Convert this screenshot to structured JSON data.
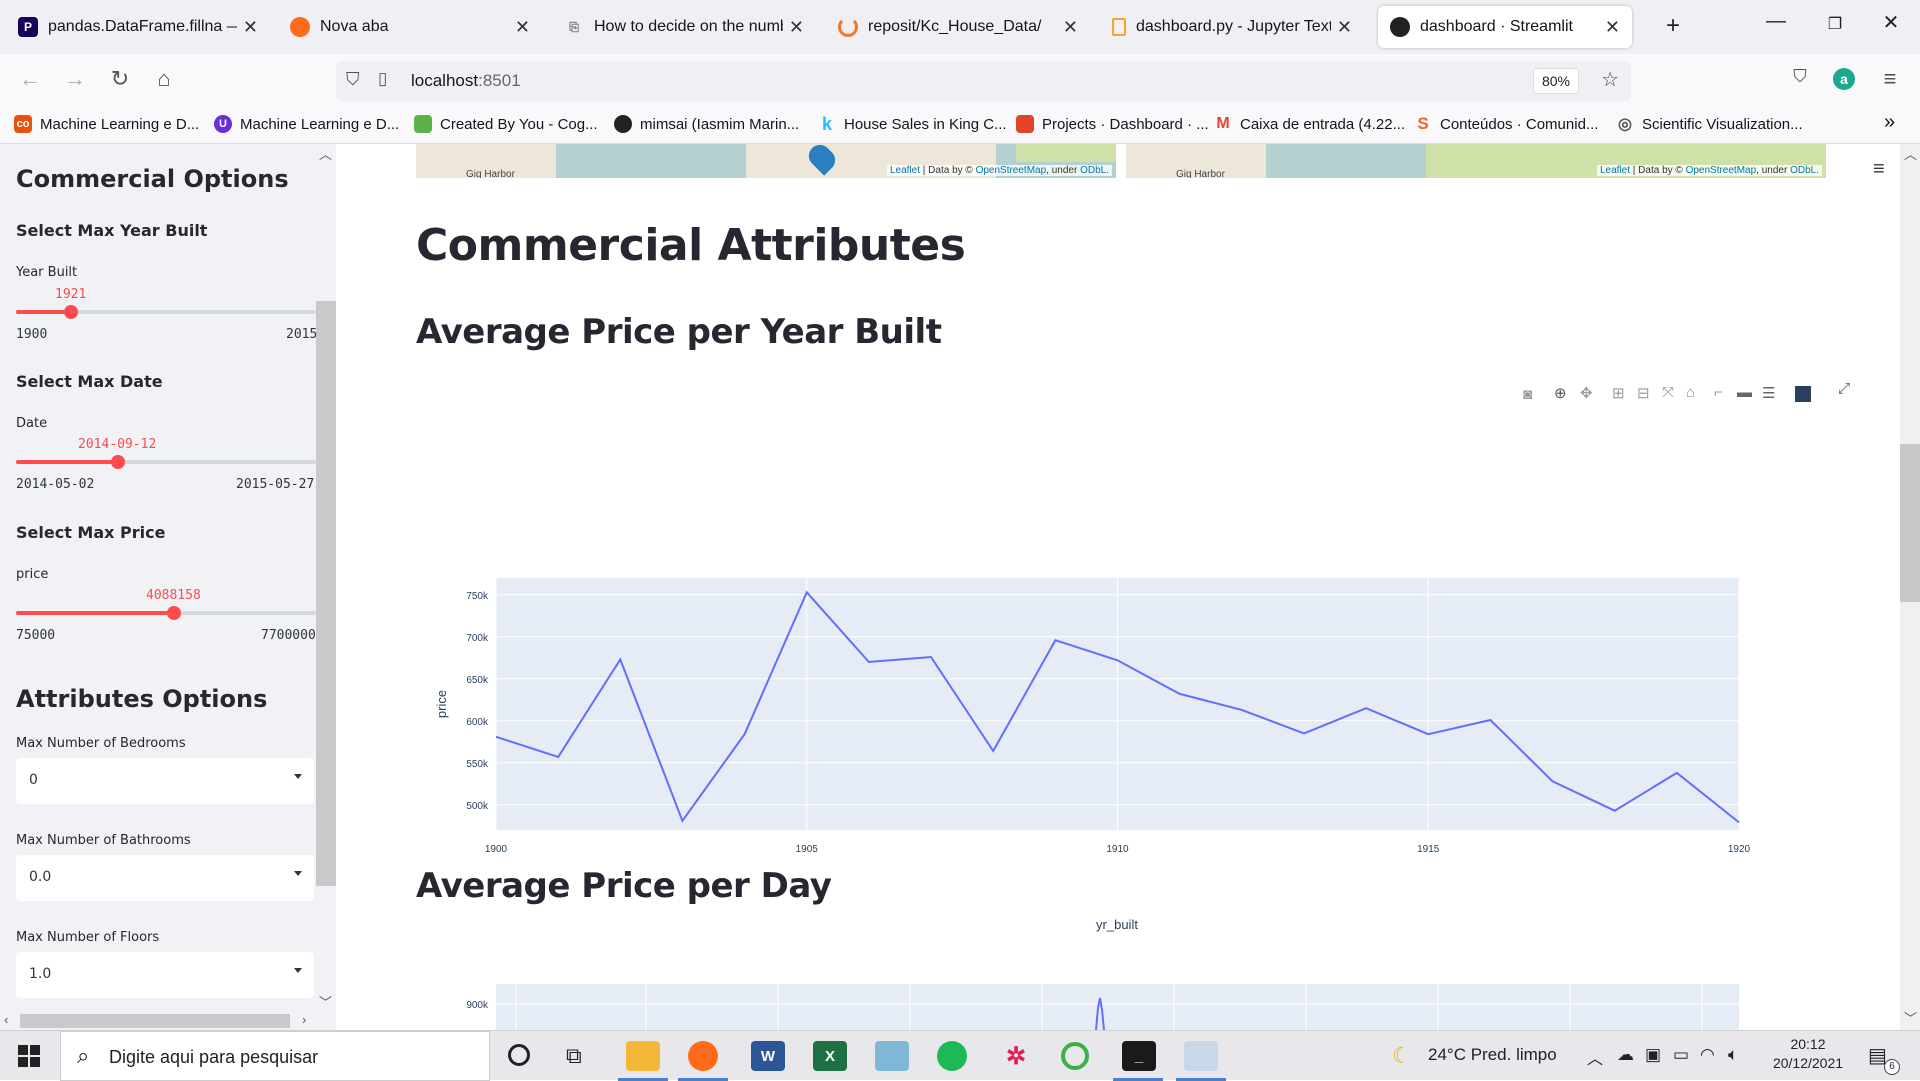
{
  "browser": {
    "tabs": [
      {
        "title": "pandas.DataFrame.fillna — par",
        "fav": "P",
        "color": "#150458"
      },
      {
        "title": "Nova aba",
        "fav": "",
        "color": "#ff6b1a"
      },
      {
        "title": "How to decide on the number",
        "fav": "",
        "color": "#888888"
      },
      {
        "title": "reposit/Kc_House_Data/",
        "fav": "",
        "color": "#f37726"
      },
      {
        "title": "dashboard.py - Jupyter Text Ed",
        "fav": "",
        "color": "#f5a623"
      },
      {
        "title": "dashboard · Streamlit",
        "fav": "",
        "color": "#222222"
      }
    ],
    "url_host": "localhost",
    "url_port": ":8501",
    "zoom": "80%",
    "bookmarks": [
      {
        "label": "Machine Learning e D...",
        "color": "#e8520c",
        "icon": "co"
      },
      {
        "label": "Machine Learning e D...",
        "color": "#6b2fd6",
        "icon": "U"
      },
      {
        "label": "Created By You - Cog...",
        "color": "#5bb24a",
        "icon": ""
      },
      {
        "label": "mimsai (Iasmim Marin...",
        "color": "#222222",
        "icon": ""
      },
      {
        "label": "House Sales in King C...",
        "color": "#20beff",
        "icon": "k"
      },
      {
        "label": "Projects · Dashboard · ...",
        "color": "#e24329",
        "icon": ""
      },
      {
        "label": "Caixa de entrada (4.22...",
        "color": "#ea4335",
        "icon": "M"
      },
      {
        "label": "Conteúdos · Comunid...",
        "color": "#f26522",
        "icon": "S"
      },
      {
        "label": "Scientific Visualization...",
        "color": "#555555",
        "icon": ""
      }
    ]
  },
  "sidebar": {
    "commercial_title": "Commercial Options",
    "year": {
      "heading": "Select Max Year Built",
      "label": "Year Built",
      "value": "1921",
      "min": "1900",
      "max": "2015",
      "fraction": 0.183
    },
    "date": {
      "heading": "Select Max Date",
      "label": "Date",
      "value": "2014-09-12",
      "min": "2014-05-02",
      "max": "2015-05-27",
      "fraction": 0.34
    },
    "price": {
      "heading": "Select Max Price",
      "label": "price",
      "value": "4088158",
      "min": "75000",
      "max": "7700000",
      "fraction": 0.526
    },
    "attributes_title": "Attributes Options",
    "bedrooms": {
      "label": "Max Number of Bedrooms",
      "value": "0"
    },
    "bathrooms": {
      "label": "Max Number of Bathrooms",
      "value": "0.0"
    },
    "floors": {
      "label": "Max Number of Floors",
      "value": "1.0"
    }
  },
  "main": {
    "map_attribution": {
      "leaflet": "Leaflet",
      "mid": " | Data by © ",
      "osm": "OpenStreetMap",
      "under": ", under ",
      "odbl": "ODbL."
    },
    "map_place": "Gig Harbor",
    "commercial_title": "Commercial Attributes",
    "chart1_title": "Average Price per Year Built",
    "chart2_title": "Average Price per Day"
  },
  "chart_data": [
    {
      "type": "line",
      "xlabel": "yr_built",
      "ylabel": "price",
      "x": [
        1900,
        1901,
        1902,
        1903,
        1904,
        1905,
        1906,
        1907,
        1908,
        1909,
        1910,
        1911,
        1912,
        1913,
        1914,
        1915,
        1916,
        1917,
        1918,
        1919,
        1920
      ],
      "y": [
        581000,
        557000,
        673000,
        481000,
        584000,
        753000,
        670000,
        676000,
        564000,
        696000,
        672000,
        632000,
        613000,
        585000,
        615000,
        584000,
        601000,
        528000,
        493000,
        538000,
        479000
      ],
      "xlim": [
        1900,
        1920
      ],
      "x_ticks": [
        1900,
        1905,
        1910,
        1915,
        1920
      ],
      "ylim": [
        470000,
        770000
      ],
      "y_ticks": [
        500000,
        550000,
        600000,
        650000,
        700000,
        750000
      ],
      "y_tick_labels": [
        "500k",
        "550k",
        "600k",
        "650k",
        "700k",
        "750k"
      ],
      "line_color": "#636efa",
      "grid": true
    },
    {
      "type": "line",
      "y_tick_labels": [
        "900k"
      ],
      "line_color": "#636efa",
      "grid": true
    }
  ],
  "taskbar": {
    "search_placeholder": "Digite aqui para pesquisar",
    "weather": "24°C  Pred. limpo",
    "time": "20:12",
    "date": "20/12/2021",
    "notif_count": "6"
  }
}
